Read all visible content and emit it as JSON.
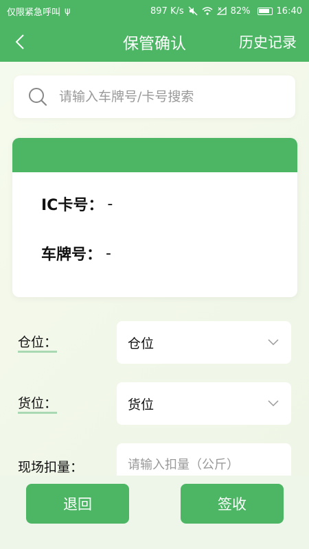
{
  "status_bar": {
    "carrier": "仅限紧急呼叫",
    "usb_symbol": "ψ",
    "speed": "897 K/s",
    "battery": "82%",
    "time": "16:40"
  },
  "header": {
    "title": "保管确认",
    "history_label": "历史记录"
  },
  "search": {
    "placeholder": "请输入车牌号/卡号搜索",
    "value": ""
  },
  "card": {
    "ic_label": "IC卡号：",
    "ic_value": "-",
    "plate_label": "车牌号：",
    "plate_value": "-"
  },
  "form": {
    "warehouse_label": "仓位：",
    "warehouse_value": "仓位",
    "cargo_label": "货位：",
    "cargo_value": "货位",
    "deduction_label": "现场扣量：",
    "deduction_placeholder": "请输入扣量（公斤）",
    "deduction_value": ""
  },
  "actions": {
    "return_label": "退回",
    "sign_label": "签收"
  },
  "colors": {
    "accent": "#4db665",
    "label_underline": "#a8d9b3"
  }
}
